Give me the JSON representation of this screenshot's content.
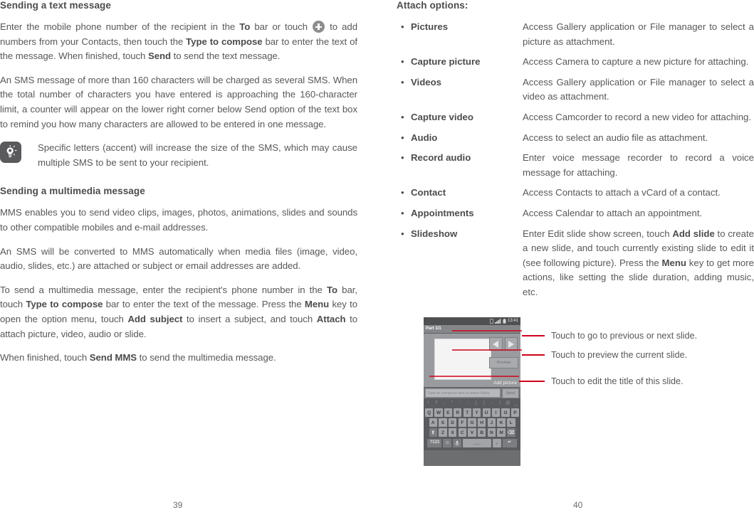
{
  "colors": {
    "body_text": "#58585a",
    "heading_text": "#4c4c4e",
    "callout_line": "#d0021b",
    "tip_icon_bg": "#5a5a5c",
    "plus_icon_bg": "#8d8d8f"
  },
  "left_page": {
    "page_number": "39",
    "heading_1": "Sending a text message",
    "paragraph_1_a": "Enter the mobile phone number of the recipient in the ",
    "paragraph_1_b": "To",
    "paragraph_1_c": " bar or touch ",
    "paragraph_1_d": " to add numbers from your Contacts, then touch the ",
    "paragraph_1_e": "Type to compose",
    "paragraph_1_f": " bar to enter the text of the message. When finished, touch ",
    "paragraph_1_g": "Send",
    "paragraph_1_h": " to send the text message.",
    "paragraph_2": "An SMS message of more than 160 characters will be charged as several SMS. When the total number of characters you have entered is approaching the 160-character limit, a counter will appear on the lower right corner below Send option of the text box to remind you how many characters are allowed to be entered in one message.",
    "tip_text": "Specific letters (accent) will increase the size of the SMS, which may cause multiple SMS to be sent to your recipient.",
    "heading_2": "Sending a multimedia message",
    "paragraph_3": "MMS enables you to send video clips, images, photos, animations, slides and sounds to other compatible mobiles and e-mail addresses.",
    "paragraph_4": "An SMS will be converted to MMS automatically when media files (image, video, audio, slides, etc.) are attached or subject or email addresses are added.",
    "paragraph_5_a": "To send a multimedia message, enter the recipient's phone number in the ",
    "paragraph_5_b": "To",
    "paragraph_5_c": " bar, touch ",
    "paragraph_5_d": "Type to compose",
    "paragraph_5_e": " bar to enter the text of the message. Press the ",
    "paragraph_5_f": "Menu",
    "paragraph_5_g": " key to open the option menu, touch ",
    "paragraph_5_h": "Add subject",
    "paragraph_5_i": " to insert a subject, and touch ",
    "paragraph_5_j": "Attach",
    "paragraph_5_k": " to attach picture, video, audio or slide.",
    "paragraph_6_a": "When finished, touch ",
    "paragraph_6_b": "Send MMS",
    "paragraph_6_c": " to send the multimedia message."
  },
  "right_page": {
    "page_number": "40",
    "heading": "Attach options:",
    "bullet_char": "•",
    "options": [
      {
        "term": "Pictures",
        "desc": "Access Gallery application or File manager to select a picture as attachment.",
        "justify": true
      },
      {
        "term": "Capture picture",
        "desc": "Access Camera to capture a new picture for attaching.",
        "justify": false
      },
      {
        "term": "Videos",
        "desc": "Access Gallery application or File manager to select a video as attachment.",
        "justify": true
      },
      {
        "term": "Capture video",
        "desc": "Access Camcorder to record a new video for attaching.",
        "justify": false
      },
      {
        "term": "Audio",
        "desc": "Access to select an audio file as attachment.",
        "justify": false
      },
      {
        "term": "Record audio",
        "desc": "Enter voice message recorder to record a voice message for attaching.",
        "justify": true
      },
      {
        "term": "Contact",
        "desc": "Access Contacts to attach a vCard of a contact.",
        "justify": false
      },
      {
        "term": "Appointments",
        "desc": "Access Calendar to attach an appointment.",
        "justify": false
      }
    ],
    "slideshow": {
      "term": "Slideshow",
      "desc_a": "Enter Edit slide show screen, touch ",
      "desc_b": "Add slide",
      "desc_c": " to create a new slide, and touch currently existing slide to edit it (see following picture). Press the ",
      "desc_d": "Menu",
      "desc_e": " key to get more actions, like setting the slide duration, adding music, etc."
    },
    "figure": {
      "status_clock": "13:41",
      "part_label": "Part 1/1",
      "preview_label": "Preview",
      "add_picture_label": "Add picture",
      "compose_placeholder": "Type to compose text or leave blank",
      "send_label": "Send",
      "keyboard": {
        "symbols_row": [
          "!",
          "?",
          ",",
          "\"",
          "'",
          ":",
          "(",
          ")",
          "-",
          "/",
          "@",
          "_"
        ],
        "row1": [
          "Q",
          "W",
          "E",
          "R",
          "T",
          "Y",
          "U",
          "I",
          "O",
          "P"
        ],
        "row2": [
          "A",
          "S",
          "D",
          "F",
          "G",
          "H",
          "J",
          "K",
          "L"
        ],
        "row3": [
          "Z",
          "X",
          "C",
          "V",
          "B",
          "N",
          "M"
        ],
        "shift_key": "⬆",
        "backspace_key": "⌫",
        "num_key": "?123",
        "emoji_key": "☺",
        "mic_key": "🎤",
        "space_key": "___",
        "period_key": ".",
        "enter_key": "↵"
      },
      "callouts": [
        {
          "text": "Touch to go to previous or next slide."
        },
        {
          "text": "Touch to preview the current slide."
        },
        {
          "text": "Touch to edit the title of this slide."
        }
      ]
    }
  }
}
